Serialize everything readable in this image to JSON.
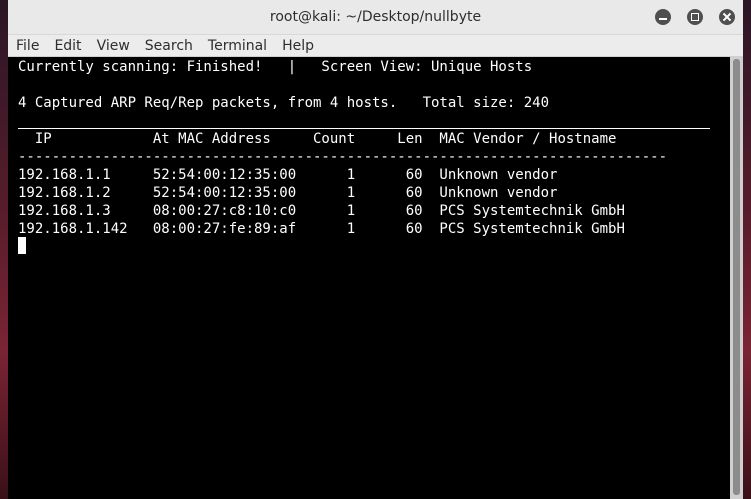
{
  "window": {
    "title": "root@kali: ~/Desktop/nullbyte",
    "buttons": [
      "minimize",
      "maximize",
      "close"
    ]
  },
  "menu": [
    "File",
    "Edit",
    "View",
    "Search",
    "Terminal",
    "Help"
  ],
  "terminal": {
    "status_line": "Currently scanning: Finished!   |   Screen View: Unique Hosts",
    "summary_line": "4 Captured ARP Req/Rep packets, from 4 hosts.   Total size: 240",
    "header_line": "  IP            At MAC Address     Count     Len  MAC Vendor / Hostname",
    "separator_line": "-----------------------------------------------------------------------------",
    "rows": [
      "192.168.1.1     52:54:00:12:35:00      1      60  Unknown vendor",
      "192.168.1.2     52:54:00:12:35:00      1      60  Unknown vendor",
      "192.168.1.3     08:00:27:c8:10:c0      1      60  PCS Systemtechnik GmbH",
      "192.168.1.142   08:00:27:fe:89:af      1      60  PCS Systemtechnik GmbH"
    ]
  }
}
